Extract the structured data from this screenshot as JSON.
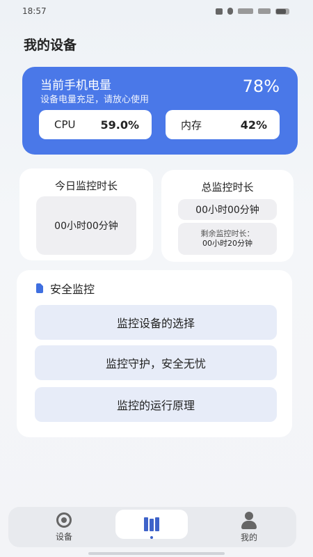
{
  "status_bar": {
    "time": "18:57"
  },
  "page_title": "我的设备",
  "battery_card": {
    "title": "当前手机电量",
    "subtitle": "设备电量充足，请放心使用",
    "percent": "78%",
    "cpu_label": "CPU",
    "cpu_value": "59.0%",
    "mem_label": "内存",
    "mem_value": "42%"
  },
  "today_card": {
    "title": "今日监控时长",
    "value": "00小时00分钟"
  },
  "total_card": {
    "title": "总监控时长",
    "value": "00小时00分钟",
    "remaining_label": "剩余监控时长：",
    "remaining_value": "00小时20分钟"
  },
  "security": {
    "title": "安全监控",
    "buttons": [
      "监控设备的选择",
      "监控守护，安全无忧",
      "监控的运行原理"
    ]
  },
  "bottom_nav": {
    "items": [
      {
        "label": "设备",
        "icon": "device-icon"
      },
      {
        "label": "",
        "icon": "book-icon",
        "active": true
      },
      {
        "label": "我的",
        "icon": "user-icon"
      }
    ]
  },
  "colors": {
    "accent": "#4a78e8",
    "button_bg": "#e7ecf8"
  }
}
